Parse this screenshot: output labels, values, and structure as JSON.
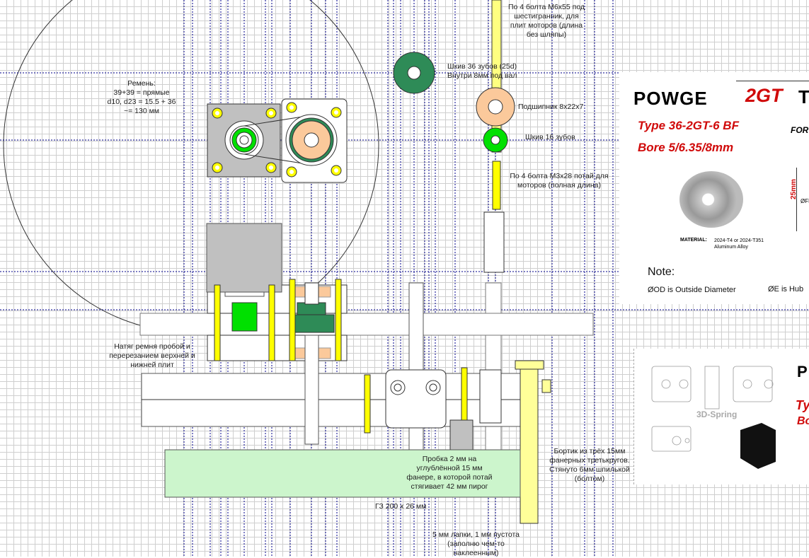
{
  "labels": {
    "belt": [
      "Ремень:",
      "39+39 = прямые",
      "d10, d23 = 15.5 + 36",
      "~= 130 мм"
    ],
    "bolts_m6": [
      "По 4 болта M6x55 под",
      "шестигранник, для",
      "плит моторов (длина",
      "без шляпы)"
    ],
    "pulley36": [
      "Шкив 36 зубов (25d)",
      "Внутри 8мм под вал"
    ],
    "bearing": "Подшипник 8x22x7",
    "pulley16": "Шкив 16 зубов",
    "bolts_m3": [
      "По 4 болта M3x28 потай для",
      "моторов (полная длина)"
    ],
    "tension": [
      "Натяг ремня пробой и",
      "перерезанием верхней и",
      "нижней плит"
    ],
    "cork": [
      "Пробка 2 мм на",
      "углублённой 15 мм",
      "фанере, в которой потай",
      "стягивает 42 мм пирог"
    ],
    "rim": [
      "Бортик из трёх 15мм",
      "фанерных третькругов.",
      "Стянуто 6мм шпилькой",
      "(болтом)"
    ],
    "gz": "ГЗ 200 x 26 мм",
    "feet": [
      "5 мм лапки, 1 мм пустота",
      "(заполню чем-то",
      "наклеенным)"
    ]
  },
  "product": {
    "brand": "POWGE",
    "series": "2GT",
    "series_tail": "T",
    "type": "Type  36-2GT-6 BF",
    "bore": "Bore 5/6.35/8mm",
    "for": "FOR",
    "height_dim": "25mm",
    "fd": "ØFD",
    "material_label": "MATERIAL:",
    "material_value": [
      "2024-T4 or 2024-T351",
      "Aluminum Alloy"
    ],
    "note_title": "Note:",
    "note_od": "ØOD is  Outside Diameter",
    "note_e": "ØE is Hub"
  },
  "drawing2": {
    "watermark": "3D-Spring",
    "brand_partial": "P",
    "type_partial": "Ty",
    "bore_partial": "Bo"
  },
  "colors": {
    "guide": "#00008b",
    "bolt": "#ffff00",
    "pulley_big": "#2e8b57",
    "pulley_small": "#00e000",
    "bearing": "#fbc99b",
    "motor": "#c0c0c0",
    "note_box": "#ccf5cc"
  }
}
